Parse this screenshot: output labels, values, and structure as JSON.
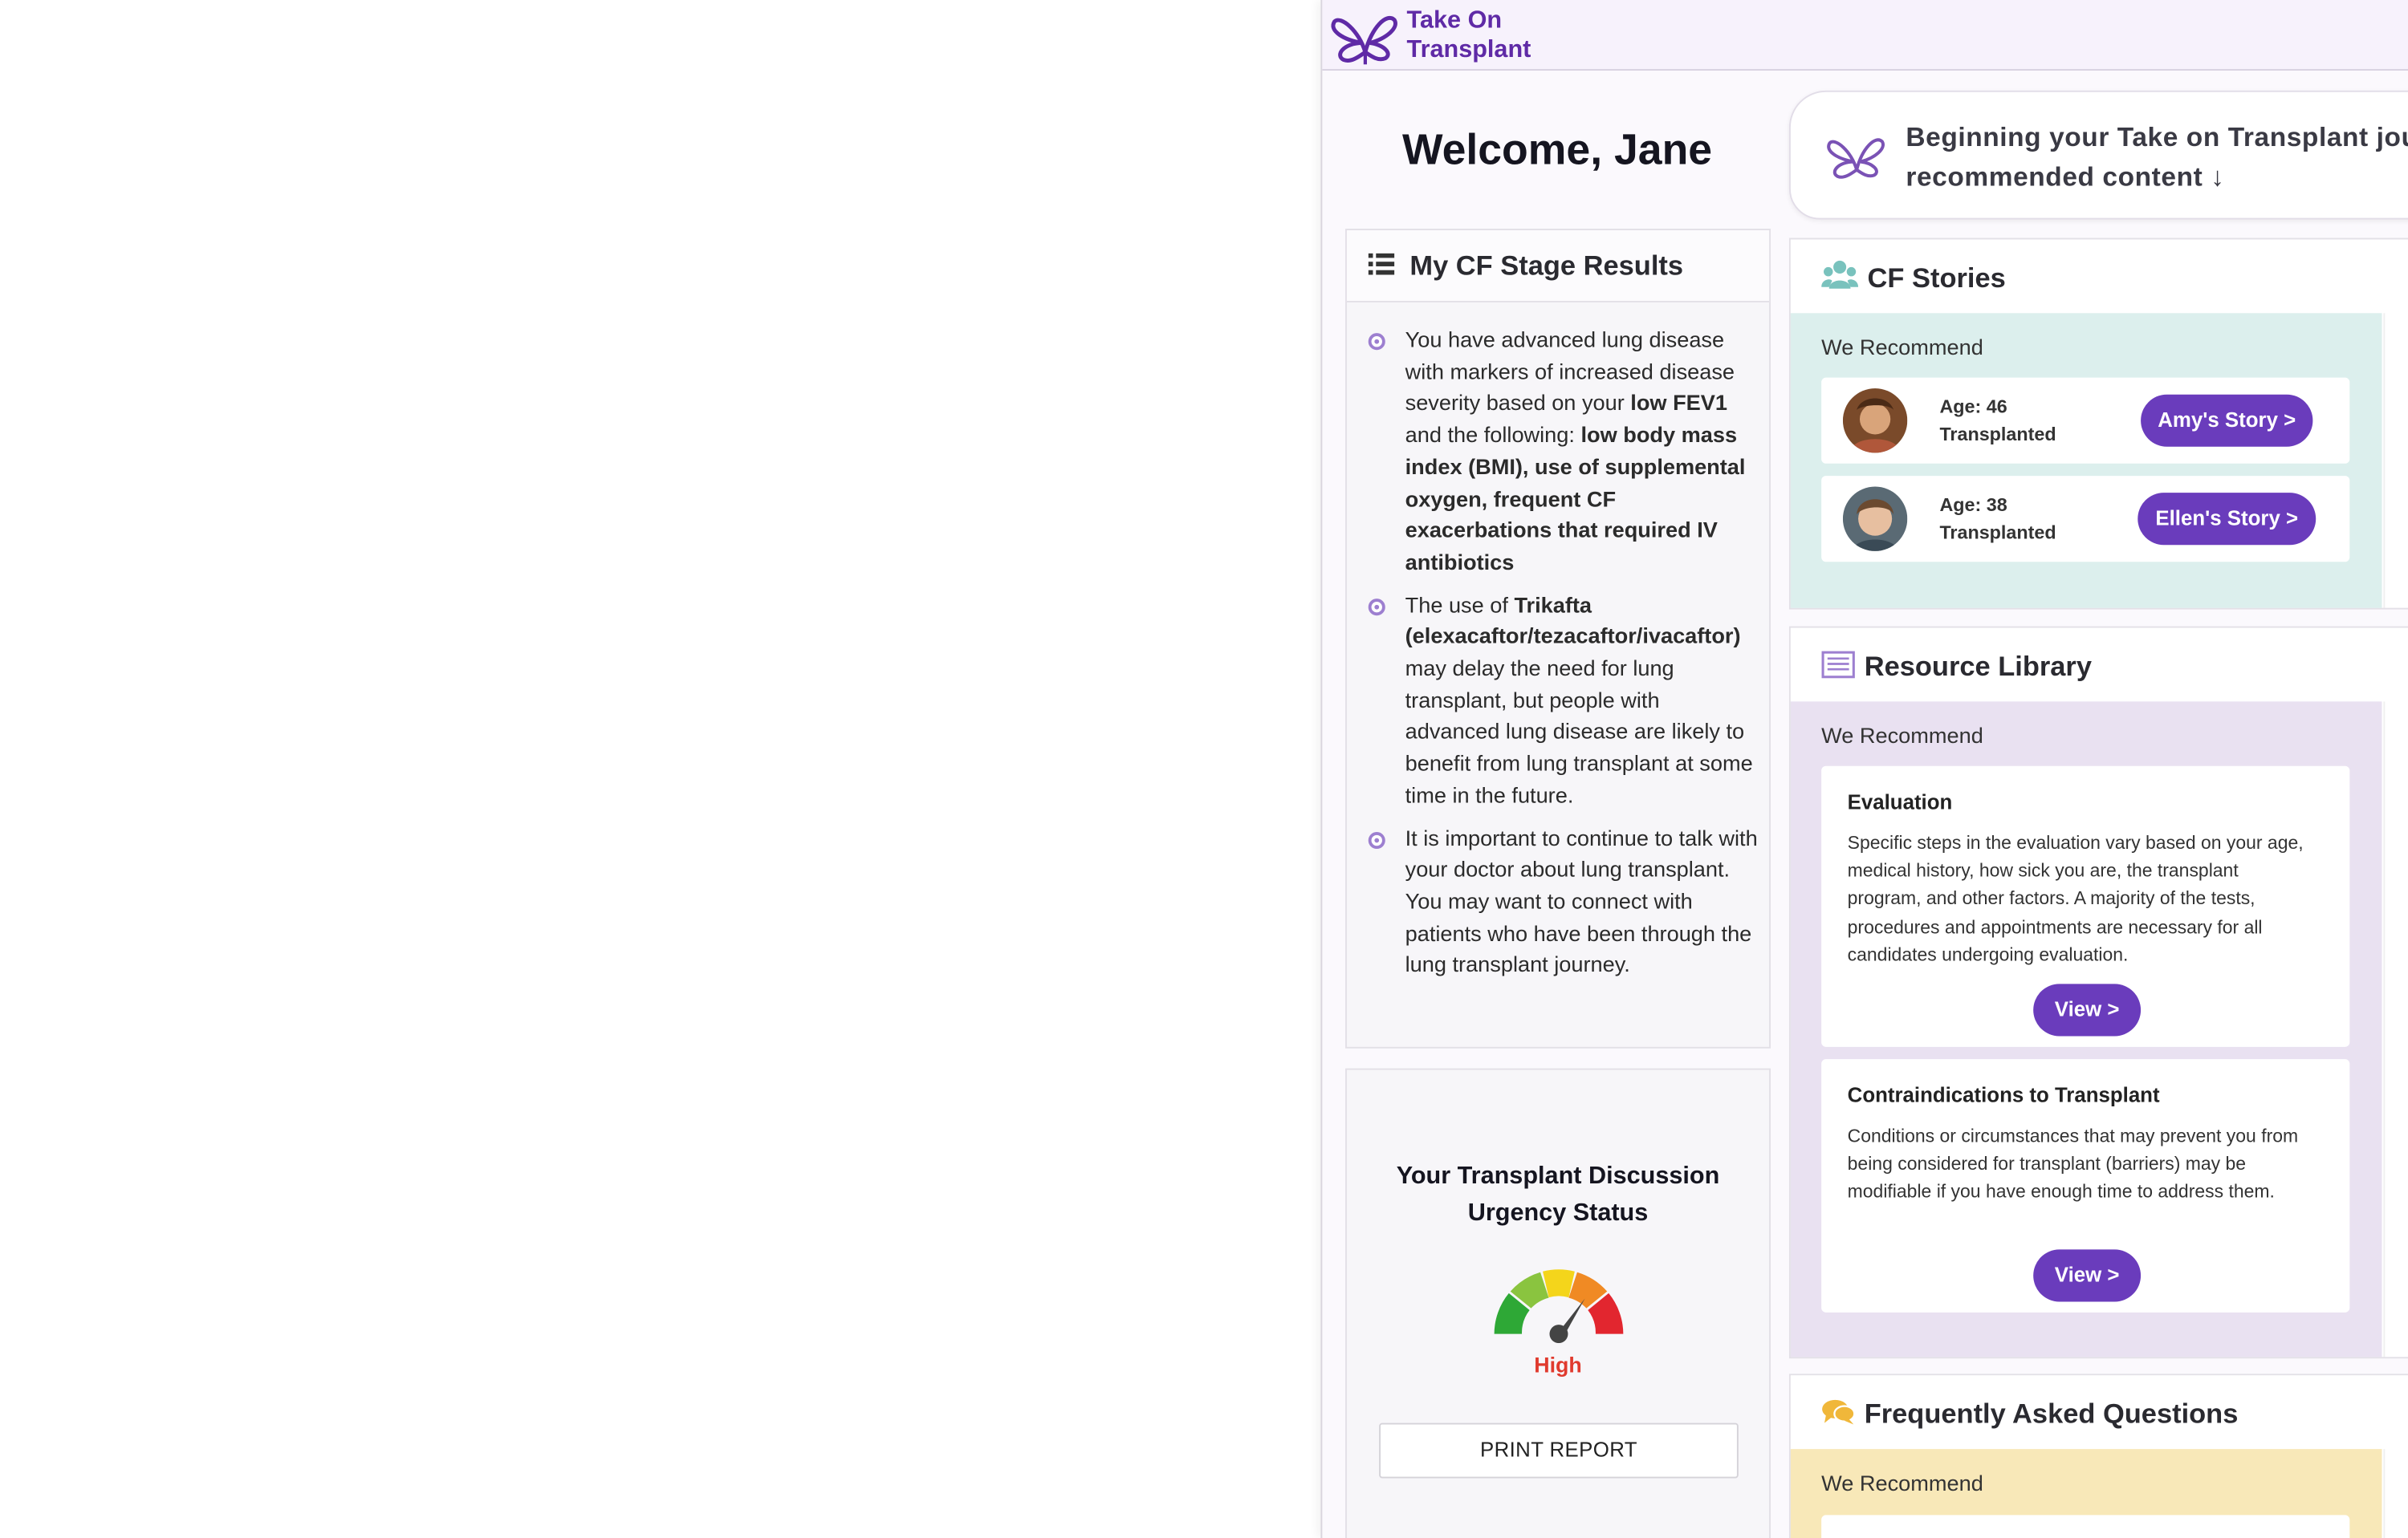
{
  "header": {
    "brand": "Take On\nTransplant"
  },
  "welcome": {
    "title": "Welcome, Jane"
  },
  "journey_banner": {
    "text": "Beginning your Take on Transplant jour\nrecommended content ↓"
  },
  "cf_stage": {
    "title": "My CF Stage Results",
    "bullets": [
      {
        "parts": [
          {
            "text": "You have advanced lung disease with markers of increased disease severity based on your ",
            "bold": false
          },
          {
            "text": "low FEV1",
            "bold": true
          },
          {
            "text": " and the following: ",
            "bold": false
          },
          {
            "text": "low body mass index (BMI), use of supplemental oxygen, frequent CF exacerbations that required IV antibiotics",
            "bold": true
          }
        ]
      },
      {
        "parts": [
          {
            "text": "The use of ",
            "bold": false
          },
          {
            "text": "Trikafta (elexacaftor/tezacaftor/ivacaftor)",
            "bold": true
          },
          {
            "text": " may delay the need for lung transplant, but people with advanced lung disease are likely to benefit from lung transplant at some time in the future.",
            "bold": false
          }
        ]
      },
      {
        "parts": [
          {
            "text": "It is important to continue to talk with your doctor about lung transplant. You may want to connect with patients who have been through the lung transplant journey.",
            "bold": false
          }
        ]
      }
    ]
  },
  "urgency": {
    "title": "Your Transplant Discussion Urgency Status",
    "level": "High",
    "print_label": "PRINT REPORT",
    "colors": {
      "green": "#2ea836",
      "light_green": "#8ac43f",
      "yellow": "#f4d51b",
      "orange": "#f08a24",
      "red": "#e2262f"
    }
  },
  "cf_stories": {
    "title": "CF Stories",
    "recommend_label": "We Recommend",
    "items": [
      {
        "age": "Age: 46",
        "status": "Transplanted",
        "button": "Amy's Story >"
      },
      {
        "age": "Age: 38",
        "status": "Transplanted",
        "button": "Ellen's Story >"
      }
    ]
  },
  "resource_library": {
    "title": "Resource Library",
    "recommend_label": "We Recommend",
    "items": [
      {
        "title": "Evaluation",
        "text": "Specific steps in the evaluation vary based on your age, medical history, how sick you are, the transplant program, and other factors. A majority of the tests, procedures and appointments are necessary for all candidates undergoing evaluation.",
        "button": "View >"
      },
      {
        "title": "Contraindications to Transplant",
        "text": "Conditions or circumstances that may prevent you from being considered for transplant (barriers) may be modifiable if you have enough time to address them.",
        "button": "View >"
      }
    ]
  },
  "faq": {
    "title": "Frequently Asked Questions",
    "recommend_label": "We Recommend"
  },
  "theme": {
    "brand_purple": "#5f2aa6",
    "button_purple": "#6a3cbc",
    "stories_bg": "#dcefed",
    "library_bg": "#e9e1f1",
    "faq_bg": "#f8e8b8"
  }
}
